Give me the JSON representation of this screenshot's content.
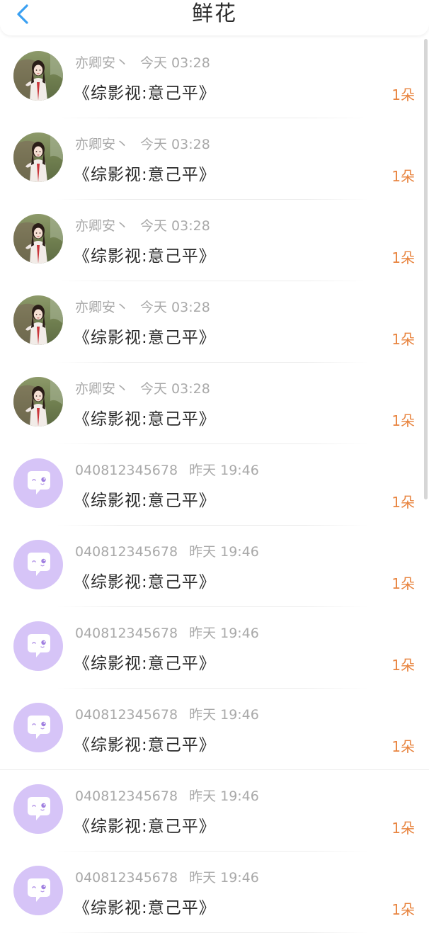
{
  "header": {
    "title": "鲜花"
  },
  "rows": [
    {
      "name": "亦卿安丶",
      "time": "今天 03:28",
      "book": "《综影视:意己平》",
      "count": "1朵",
      "avatar": "girl-avatar-icon"
    },
    {
      "name": "亦卿安丶",
      "time": "今天 03:28",
      "book": "《综影视:意己平》",
      "count": "1朵",
      "avatar": "girl-avatar-icon"
    },
    {
      "name": "亦卿安丶",
      "time": "今天 03:28",
      "book": "《综影视:意己平》",
      "count": "1朵",
      "avatar": "girl-avatar-icon"
    },
    {
      "name": "亦卿安丶",
      "time": "今天 03:28",
      "book": "《综影视:意己平》",
      "count": "1朵",
      "avatar": "girl-avatar-icon"
    },
    {
      "name": "亦卿安丶",
      "time": "今天 03:28",
      "book": "《综影视:意己平》",
      "count": "1朵",
      "avatar": "girl-avatar-icon"
    },
    {
      "name": "040812345678",
      "time": "昨天 19:46",
      "book": "《综影视:意己平》",
      "count": "1朵",
      "avatar": "chat-bubble-avatar-icon"
    },
    {
      "name": "040812345678",
      "time": "昨天 19:46",
      "book": "《综影视:意己平》",
      "count": "1朵",
      "avatar": "chat-bubble-avatar-icon"
    },
    {
      "name": "040812345678",
      "time": "昨天 19:46",
      "book": "《综影视:意己平》",
      "count": "1朵",
      "avatar": "chat-bubble-avatar-icon"
    },
    {
      "name": "040812345678",
      "time": "昨天 19:46",
      "book": "《综影视:意己平》",
      "count": "1朵",
      "avatar": "chat-bubble-avatar-icon"
    },
    {
      "name": "040812345678",
      "time": "昨天 19:46",
      "book": "《综影视:意己平》",
      "count": "1朵",
      "avatar": "chat-bubble-avatar-icon"
    },
    {
      "name": "040812345678",
      "time": "昨天 19:46",
      "book": "《综影视:意己平》",
      "count": "1朵",
      "avatar": "chat-bubble-avatar-icon"
    }
  ],
  "colors": {
    "back_arrow": "#3aa0f2",
    "count": "#e8843f",
    "default_avatar_bg": "#d6c4f7"
  }
}
